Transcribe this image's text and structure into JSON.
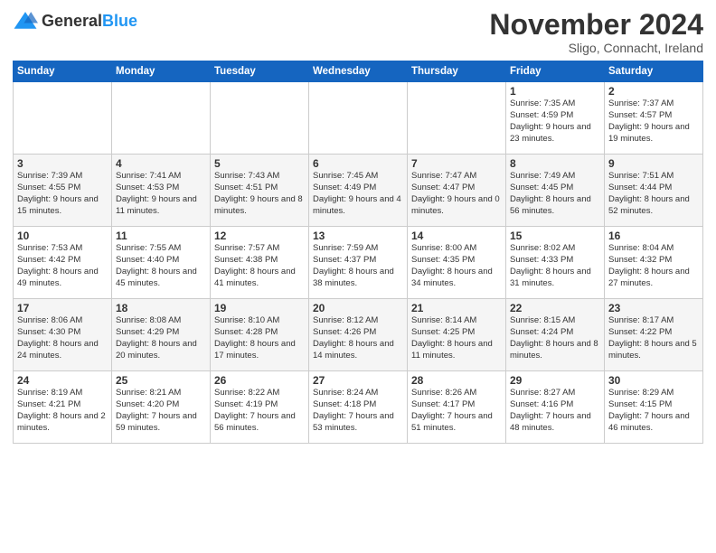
{
  "logo": {
    "general": "General",
    "blue": "Blue"
  },
  "header": {
    "month": "November 2024",
    "location": "Sligo, Connacht, Ireland"
  },
  "weekdays": [
    "Sunday",
    "Monday",
    "Tuesday",
    "Wednesday",
    "Thursday",
    "Friday",
    "Saturday"
  ],
  "weeks": [
    [
      {
        "day": "",
        "info": ""
      },
      {
        "day": "",
        "info": ""
      },
      {
        "day": "",
        "info": ""
      },
      {
        "day": "",
        "info": ""
      },
      {
        "day": "",
        "info": ""
      },
      {
        "day": "1",
        "info": "Sunrise: 7:35 AM\nSunset: 4:59 PM\nDaylight: 9 hours\nand 23 minutes."
      },
      {
        "day": "2",
        "info": "Sunrise: 7:37 AM\nSunset: 4:57 PM\nDaylight: 9 hours\nand 19 minutes."
      }
    ],
    [
      {
        "day": "3",
        "info": "Sunrise: 7:39 AM\nSunset: 4:55 PM\nDaylight: 9 hours\nand 15 minutes."
      },
      {
        "day": "4",
        "info": "Sunrise: 7:41 AM\nSunset: 4:53 PM\nDaylight: 9 hours\nand 11 minutes."
      },
      {
        "day": "5",
        "info": "Sunrise: 7:43 AM\nSunset: 4:51 PM\nDaylight: 9 hours\nand 8 minutes."
      },
      {
        "day": "6",
        "info": "Sunrise: 7:45 AM\nSunset: 4:49 PM\nDaylight: 9 hours\nand 4 minutes."
      },
      {
        "day": "7",
        "info": "Sunrise: 7:47 AM\nSunset: 4:47 PM\nDaylight: 9 hours\nand 0 minutes."
      },
      {
        "day": "8",
        "info": "Sunrise: 7:49 AM\nSunset: 4:45 PM\nDaylight: 8 hours\nand 56 minutes."
      },
      {
        "day": "9",
        "info": "Sunrise: 7:51 AM\nSunset: 4:44 PM\nDaylight: 8 hours\nand 52 minutes."
      }
    ],
    [
      {
        "day": "10",
        "info": "Sunrise: 7:53 AM\nSunset: 4:42 PM\nDaylight: 8 hours\nand 49 minutes."
      },
      {
        "day": "11",
        "info": "Sunrise: 7:55 AM\nSunset: 4:40 PM\nDaylight: 8 hours\nand 45 minutes."
      },
      {
        "day": "12",
        "info": "Sunrise: 7:57 AM\nSunset: 4:38 PM\nDaylight: 8 hours\nand 41 minutes."
      },
      {
        "day": "13",
        "info": "Sunrise: 7:59 AM\nSunset: 4:37 PM\nDaylight: 8 hours\nand 38 minutes."
      },
      {
        "day": "14",
        "info": "Sunrise: 8:00 AM\nSunset: 4:35 PM\nDaylight: 8 hours\nand 34 minutes."
      },
      {
        "day": "15",
        "info": "Sunrise: 8:02 AM\nSunset: 4:33 PM\nDaylight: 8 hours\nand 31 minutes."
      },
      {
        "day": "16",
        "info": "Sunrise: 8:04 AM\nSunset: 4:32 PM\nDaylight: 8 hours\nand 27 minutes."
      }
    ],
    [
      {
        "day": "17",
        "info": "Sunrise: 8:06 AM\nSunset: 4:30 PM\nDaylight: 8 hours\nand 24 minutes."
      },
      {
        "day": "18",
        "info": "Sunrise: 8:08 AM\nSunset: 4:29 PM\nDaylight: 8 hours\nand 20 minutes."
      },
      {
        "day": "19",
        "info": "Sunrise: 8:10 AM\nSunset: 4:28 PM\nDaylight: 8 hours\nand 17 minutes."
      },
      {
        "day": "20",
        "info": "Sunrise: 8:12 AM\nSunset: 4:26 PM\nDaylight: 8 hours\nand 14 minutes."
      },
      {
        "day": "21",
        "info": "Sunrise: 8:14 AM\nSunset: 4:25 PM\nDaylight: 8 hours\nand 11 minutes."
      },
      {
        "day": "22",
        "info": "Sunrise: 8:15 AM\nSunset: 4:24 PM\nDaylight: 8 hours\nand 8 minutes."
      },
      {
        "day": "23",
        "info": "Sunrise: 8:17 AM\nSunset: 4:22 PM\nDaylight: 8 hours\nand 5 minutes."
      }
    ],
    [
      {
        "day": "24",
        "info": "Sunrise: 8:19 AM\nSunset: 4:21 PM\nDaylight: 8 hours\nand 2 minutes."
      },
      {
        "day": "25",
        "info": "Sunrise: 8:21 AM\nSunset: 4:20 PM\nDaylight: 7 hours\nand 59 minutes."
      },
      {
        "day": "26",
        "info": "Sunrise: 8:22 AM\nSunset: 4:19 PM\nDaylight: 7 hours\nand 56 minutes."
      },
      {
        "day": "27",
        "info": "Sunrise: 8:24 AM\nSunset: 4:18 PM\nDaylight: 7 hours\nand 53 minutes."
      },
      {
        "day": "28",
        "info": "Sunrise: 8:26 AM\nSunset: 4:17 PM\nDaylight: 7 hours\nand 51 minutes."
      },
      {
        "day": "29",
        "info": "Sunrise: 8:27 AM\nSunset: 4:16 PM\nDaylight: 7 hours\nand 48 minutes."
      },
      {
        "day": "30",
        "info": "Sunrise: 8:29 AM\nSunset: 4:15 PM\nDaylight: 7 hours\nand 46 minutes."
      }
    ]
  ]
}
